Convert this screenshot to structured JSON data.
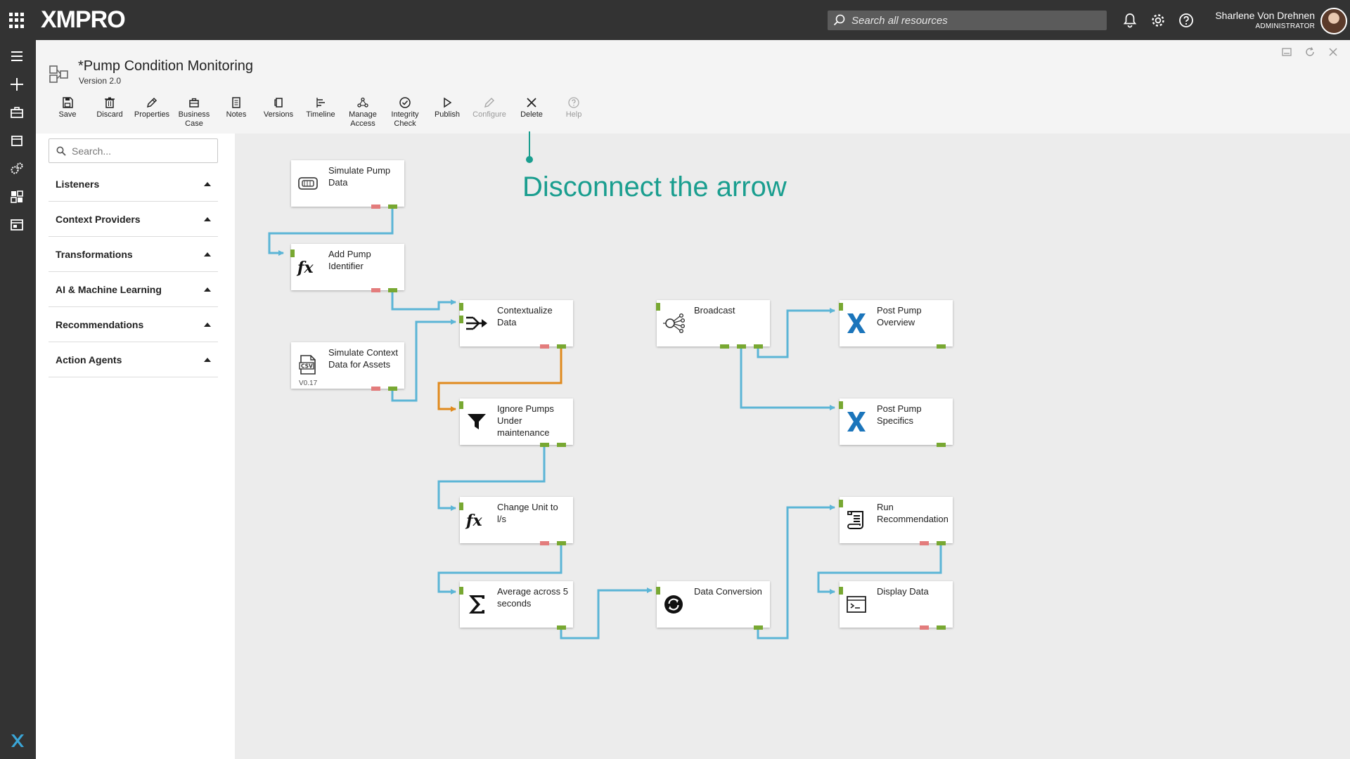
{
  "topbar": {
    "logo": "XMPRO",
    "search_placeholder": "Search all resources",
    "user_name": "Sharlene Von Drehnen",
    "user_role": "ADMINISTRATOR"
  },
  "header": {
    "title": "*Pump Condition Monitoring",
    "version": "Version 2.0"
  },
  "toolbar": {
    "save": "Save",
    "discard": "Discard",
    "properties": "Properties",
    "business_case": "Business Case",
    "notes": "Notes",
    "versions": "Versions",
    "timeline": "Timeline",
    "manage_access": "Manage Access",
    "integrity_check": "Integrity Check",
    "publish": "Publish",
    "configure": "Configure",
    "delete": "Delete",
    "help": "Help"
  },
  "sidebar": {
    "search_placeholder": "Search...",
    "categories": [
      "Listeners",
      "Context Providers",
      "Transformations",
      "AI & Machine Learning",
      "Recommendations",
      "Action Agents"
    ]
  },
  "annotation": "Disconnect the arrow",
  "nodes": {
    "simulate_pump": "Simulate Pump Data",
    "add_pump_id": "Add Pump Identifier",
    "simulate_context": "Simulate Context Data for Assets",
    "simulate_context_version": "V0.17",
    "contextualize": "Contextualize Data",
    "ignore_pumps": "Ignore Pumps Under maintenance",
    "change_unit": "Change Unit to l/s",
    "average": "Average across 5 seconds",
    "data_conversion": "Data Conversion",
    "broadcast": "Broadcast",
    "post_overview": "Post Pump Overview",
    "post_specifics": "Post Pump Specifics",
    "run_recommendation": "Run Recommendation",
    "display_data": "Display Data"
  },
  "colors": {
    "connector": "#5bb5d6",
    "selected_connector": "#e08a1e",
    "port_ok": "#78a832",
    "port_error": "#e37c7c",
    "annotation": "#1a9e8f"
  }
}
